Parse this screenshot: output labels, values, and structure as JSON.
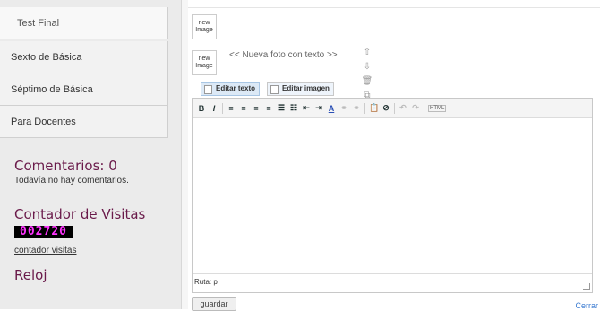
{
  "sidebar": {
    "nav_items": [
      "Test Final",
      "Sexto de Básica",
      "Séptimo de Básica",
      "Para Docentes"
    ]
  },
  "comments": {
    "title": "Comentarios: 0",
    "text": "Todavía no hay comentarios."
  },
  "counter": {
    "title": "Contador de Visitas",
    "digits": "002720",
    "link": "contador visitas"
  },
  "clock": {
    "title": "Reloj"
  },
  "main": {
    "thumb_label": "new\nImage",
    "new_photo": "<< Nueva foto con texto >>",
    "tabs": [
      {
        "label": "Editar texto",
        "active": true
      },
      {
        "label": "Editar imagen",
        "active": false
      }
    ],
    "path_text": "Ruta: p",
    "save_label": "guardar",
    "close_label": "Cerrar",
    "toolbar": {
      "bold": "B",
      "italic": "I",
      "items": [
        "≡",
        "≡",
        "≡",
        "≡",
        "☰",
        "☷",
        "⇤",
        "⇥",
        "A"
      ],
      "muted_items": [
        "⚭",
        "⚭"
      ],
      "right_items": [
        "📋",
        "⊘"
      ],
      "undo_items": [
        "↶",
        "↷"
      ],
      "html_label": "HTML"
    }
  }
}
